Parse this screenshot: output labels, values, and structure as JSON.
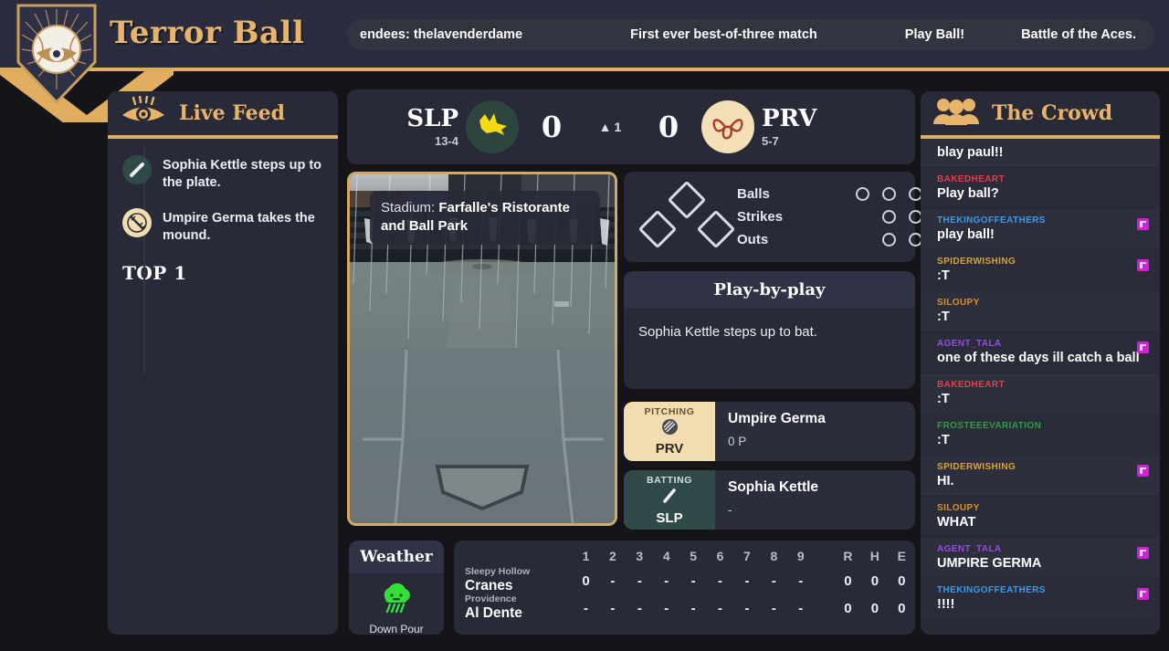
{
  "app": {
    "title": "Terror Ball",
    "logo_icon": "baseball-eye-shield-logo"
  },
  "ticker": {
    "items": [
      "endees: thelavenderdame",
      "First ever best-of-three match",
      "Play Ball!",
      "Battle of the Aces."
    ]
  },
  "live_feed": {
    "title": "Live Feed",
    "header_icon": "eye-icon",
    "items": [
      {
        "icon": "bat-icon",
        "text": "Sophia Kettle steps up to the plate."
      },
      {
        "icon": "baseball-icon",
        "text": "Umpire Germa takes the mound."
      }
    ],
    "inning_marker": "TOP 1"
  },
  "scoreboard": {
    "away": {
      "abbr": "SLP",
      "record": "13-4",
      "score": "0",
      "logo_icon": "crane-bird-icon"
    },
    "home": {
      "abbr": "PRV",
      "record": "5-7",
      "score": "0",
      "logo_icon": "farfalle-bowtie-icon"
    },
    "inning_arrow": "▲",
    "inning_number": "1"
  },
  "stadium": {
    "label_prefix": "Stadium:",
    "name": "Farfalle's Ristorante and Ball Park"
  },
  "count": {
    "rows": [
      {
        "label": "Balls",
        "total": 3,
        "filled": 0
      },
      {
        "label": "Strikes",
        "total": 2,
        "filled": 0
      },
      {
        "label": "Outs",
        "total": 2,
        "filled": 0
      }
    ],
    "bases": {
      "first": false,
      "second": false,
      "third": false
    }
  },
  "play_by_play": {
    "title": "Play-by-play",
    "text": "Sophia Kettle steps up to bat."
  },
  "lineup": {
    "pitching": {
      "tag": "PITCHING",
      "team": "PRV",
      "icon": "baseball-icon",
      "name": "Umpire Germa",
      "stat": "0 P"
    },
    "batting": {
      "tag": "BATTING",
      "team": "SLP",
      "icon": "bat-icon",
      "name": "Sophia Kettle",
      "stat": "-"
    }
  },
  "weather": {
    "title": "Weather",
    "icon": "rain-cloud-icon",
    "condition": "Down Pour"
  },
  "linescore": {
    "innings": [
      "1",
      "2",
      "3",
      "4",
      "5",
      "6",
      "7",
      "8",
      "9"
    ],
    "totals_headers": [
      "R",
      "H",
      "E"
    ],
    "teams": [
      {
        "city": "Sleepy Hollow",
        "name": "Cranes",
        "innings": [
          "0",
          "-",
          "-",
          "-",
          "-",
          "-",
          "-",
          "-",
          "-"
        ],
        "totals": [
          "0",
          "0",
          "0"
        ]
      },
      {
        "city": "Providence",
        "name": "Al Dente",
        "innings": [
          "-",
          "-",
          "-",
          "-",
          "-",
          "-",
          "-",
          "-",
          "-"
        ],
        "totals": [
          "0",
          "0",
          "0"
        ]
      }
    ]
  },
  "crowd": {
    "title": "The Crowd",
    "header_icon": "people-group-icon",
    "messages": [
      {
        "user": "",
        "user_color": "#ffffff",
        "text": "blay paul!!",
        "badge": false
      },
      {
        "user": "BAKEDHEART",
        "user_color": "#e0404a",
        "text": "Play ball?",
        "badge": false
      },
      {
        "user": "THEKINGOFFEATHERS",
        "user_color": "#3e9ae8",
        "text": "play ball!",
        "badge": true
      },
      {
        "user": "SPIDERWISHING",
        "user_color": "#d8a33c",
        "text": ":T",
        "badge": true
      },
      {
        "user": "SILOUPY",
        "user_color": "#d8922c",
        "text": ":T",
        "badge": false
      },
      {
        "user": "AGENT_TALA",
        "user_color": "#9a4ce0",
        "text": "one of these days ill catch a ball",
        "badge": true
      },
      {
        "user": "BAKEDHEART",
        "user_color": "#e0404a",
        "text": ":T",
        "badge": false
      },
      {
        "user": "FROSTEEEVARIATION",
        "user_color": "#2f9e44",
        "text": ":T",
        "badge": false
      },
      {
        "user": "SPIDERWISHING",
        "user_color": "#d8a33c",
        "text": "HI.",
        "badge": true
      },
      {
        "user": "SILOUPY",
        "user_color": "#d8922c",
        "text": "WHAT",
        "badge": false
      },
      {
        "user": "AGENT_TALA",
        "user_color": "#9a4ce0",
        "text": "UMPIRE GERMA",
        "badge": true
      },
      {
        "user": "THEKINGOFFEATHERS",
        "user_color": "#3e9ae8",
        "text": "!!!!",
        "badge": true
      }
    ]
  },
  "colors": {
    "accent_gold": "#e0ae5e",
    "panel_bg": "#282a37",
    "page_bg": "#141419",
    "header_bg": "#2b2d3f"
  }
}
